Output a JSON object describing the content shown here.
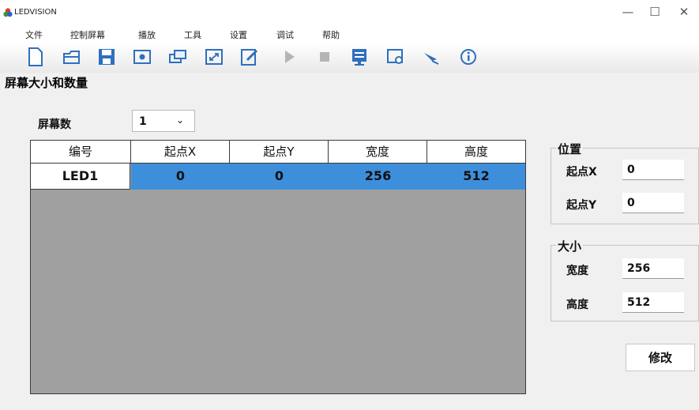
{
  "window": {
    "title": "LEDVISION",
    "minimize": "—",
    "maximize": "☐",
    "close": "✕"
  },
  "menu": [
    "文件",
    "控制屏幕",
    "播放",
    "工具",
    "设置",
    "调试",
    "帮助"
  ],
  "toolbar": {
    "icons": [
      "new-file-icon",
      "open-folder-icon",
      "save-icon",
      "preview-icon",
      "window-icon",
      "fullscreen-icon",
      "edit-icon",
      "play-icon",
      "stop-icon",
      "screen-icon",
      "settings-icon",
      "satellite-icon",
      "info-icon"
    ]
  },
  "section_title": "屏幕大小和数量",
  "screen_count": {
    "label": "屏幕数",
    "value": "1",
    "arrow": "⌄"
  },
  "table": {
    "headers": [
      "编号",
      "起点X",
      "起点Y",
      "宽度",
      "高度"
    ],
    "rows": [
      {
        "id": "LED1",
        "x": "0",
        "y": "0",
        "width": "256",
        "height": "512"
      }
    ]
  },
  "position_group": {
    "title": "位置",
    "x_label": "起点X",
    "x_value": "0",
    "y_label": "起点Y",
    "y_value": "0"
  },
  "size_group": {
    "title": "大小",
    "width_label": "宽度",
    "width_value": "256",
    "height_label": "高度",
    "height_value": "512"
  },
  "modify_button": "修改",
  "colors": {
    "selection": "#3d8fdc",
    "grid_background": "#a0a0a0"
  }
}
